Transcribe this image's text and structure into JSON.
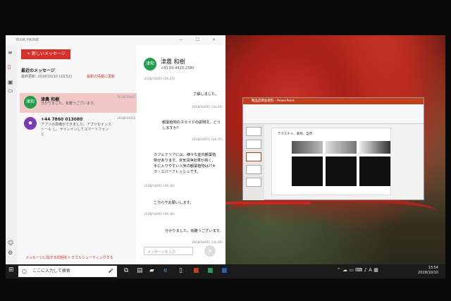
{
  "app": {
    "title": "YOUR PHONE",
    "new_message": "新しいメッセージ",
    "recent_title": "最近のメッセージ",
    "updated": "最終更新: 2018/10/10 (10:52)",
    "refresh": "最新の情報に更新",
    "troubleshoot": "メッセージに関する問題をトラブルシューティングする"
  },
  "conversations": [
    {
      "avatar": "津和",
      "name": "津農 和樹",
      "date": "2018/10/05",
      "preview": "分かりました。有難うございます。",
      "color": "#1f9d4a"
    },
    {
      "avatar": "",
      "name": "+44 7860 013080",
      "date": "2018/10/03",
      "preview": "アプリの準備ができました。アプリをインストール し、サインインしてスマートフォンと",
      "color": "#7a3bb5"
    }
  ],
  "chat": {
    "avatar": "津和",
    "name": "津農 和樹",
    "number": "+81 80-4420-2380",
    "messages": [
      {
        "ts": "2018/10/05 (18:34)",
        "text": ""
      },
      {
        "ts": "",
        "text": "了解しました。"
      },
      {
        "ts": "2018/10/05 (18:34)",
        "text": ""
      },
      {
        "ts": "",
        "text": "観葉植物のスライドの説明文、どうしますか?"
      },
      {
        "ts": "2018/10/05 (18:35)",
        "text": ""
      },
      {
        "ts": "",
        "text": "カフェテリアには、様々な室内観葉植物があります。京気清浄効果が高く、手に入りやすい人気の観葉植物はパキラ・エバーフレッシュです。"
      },
      {
        "ts": "2018/10/05 (18:36)",
        "text": ""
      },
      {
        "ts": "",
        "text": "こちらでお願いします。"
      },
      {
        "ts": "2018/10/05 (18:36)",
        "text": ""
      },
      {
        "ts": "",
        "text": "分かりました。有難うございます。"
      },
      {
        "ts": "2018/10/05 (18:36)",
        "text": ""
      }
    ],
    "input_placeholder": "メッセージを入力"
  },
  "ppt": {
    "title": "製品説明会資料 - PowerPoint",
    "slide_title": "テクスチャ、素材、自然"
  },
  "taskbar": {
    "search": "ここに入力して検索",
    "time": "13:54",
    "date": "2018/10/10"
  },
  "colors": {
    "accent": "#d9302a",
    "ppt": "#c43e1c"
  }
}
